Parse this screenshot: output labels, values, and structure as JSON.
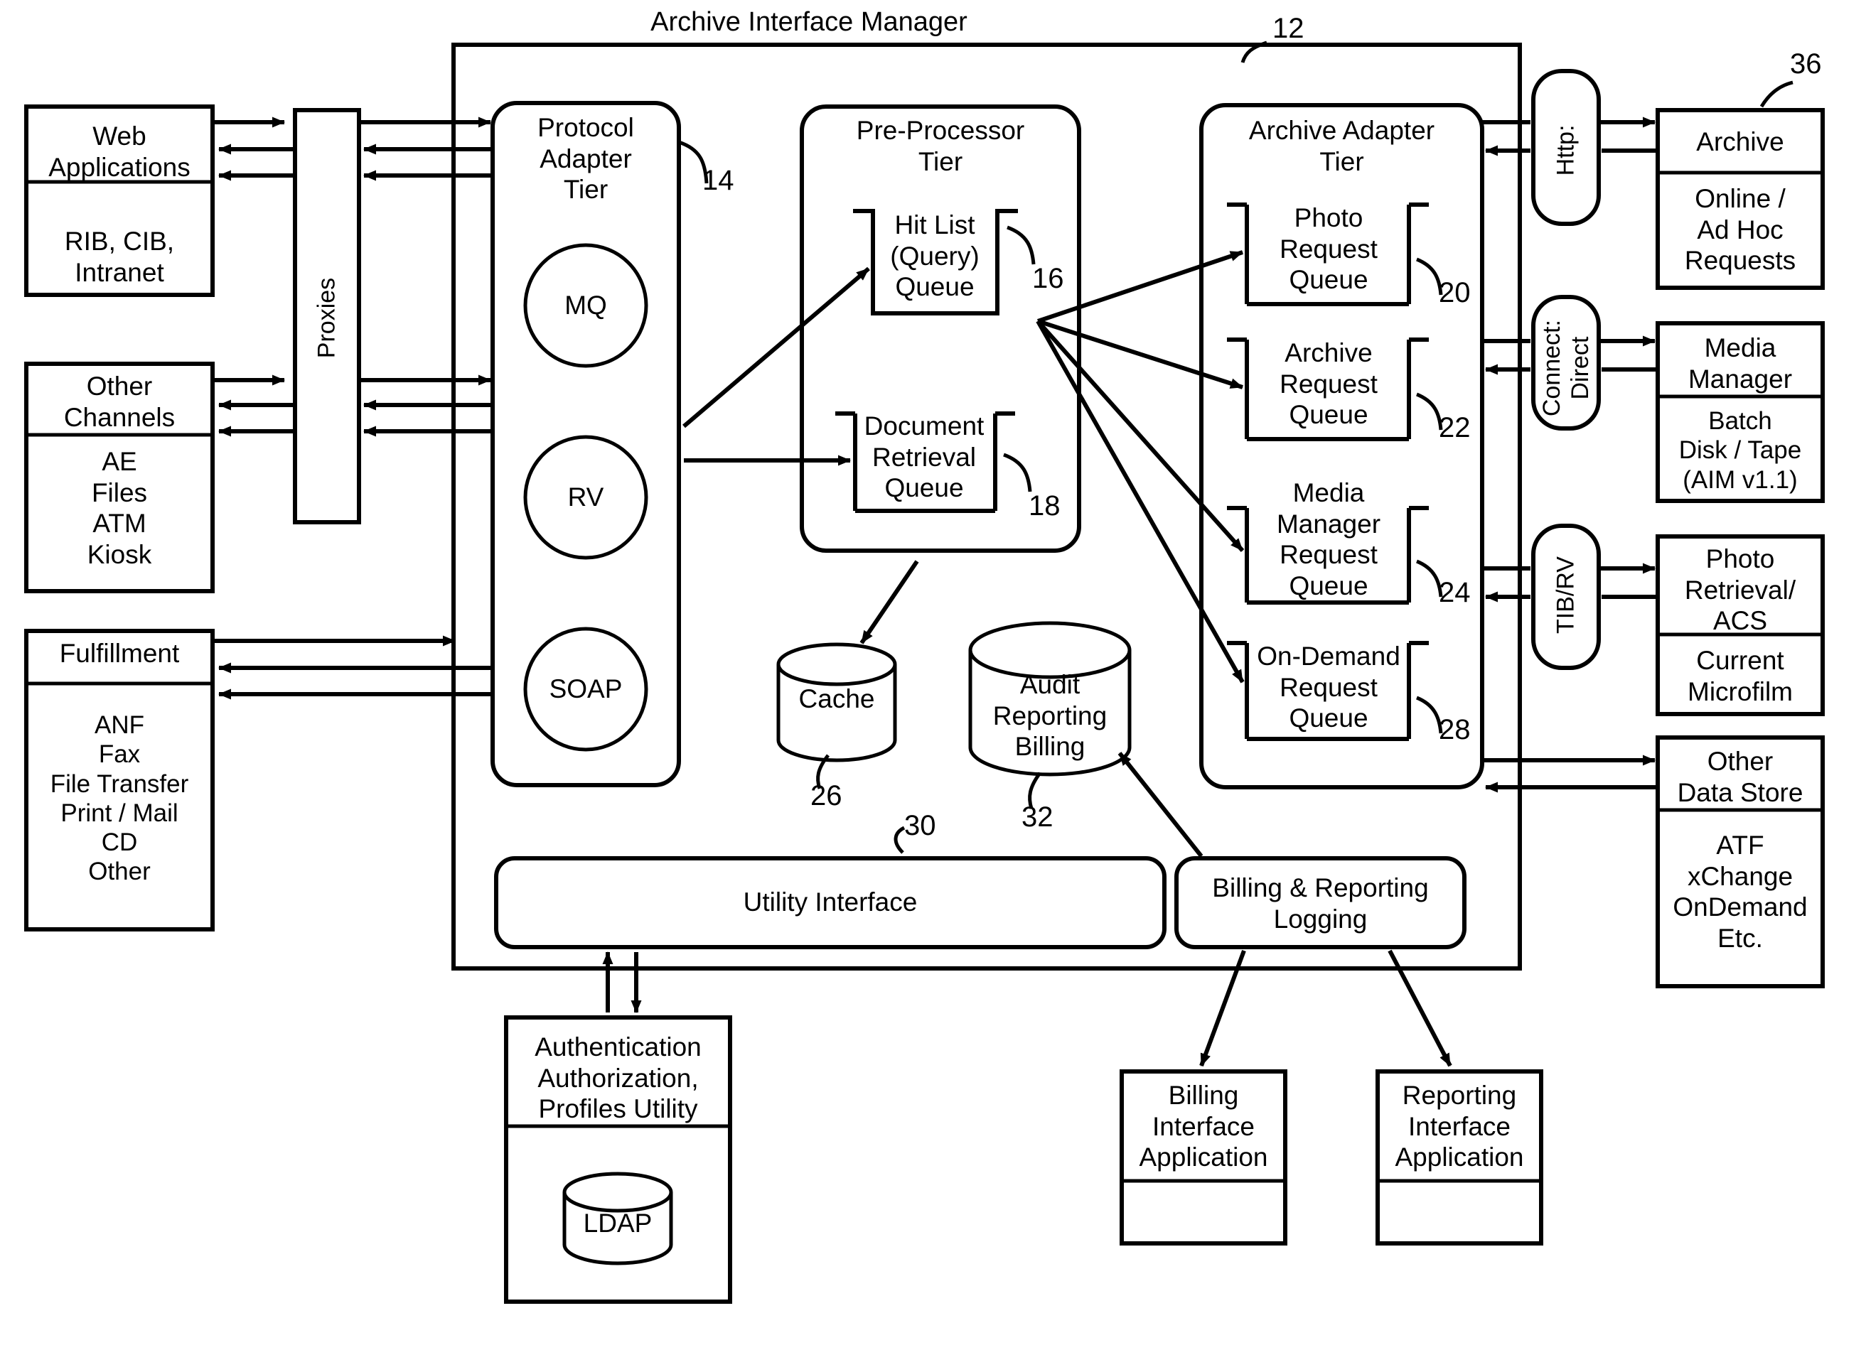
{
  "diagram": {
    "title": "Archive Interface Manager",
    "ref_main": "12"
  },
  "left_column": [
    {
      "name": "web-applications",
      "header": "Web\nApplications",
      "body": "RIB, CIB,\nIntranet"
    },
    {
      "name": "other-channels",
      "header": "Other\nChannels",
      "body": "AE\nFiles\nATM\nKiosk"
    },
    {
      "name": "fulfillment",
      "header": "Fulfillment",
      "body": "ANF\nFax\nFile Transfer\nPrint / Mail\nCD\nOther"
    }
  ],
  "proxies": {
    "label": "Proxies"
  },
  "protocol_adapter_tier": {
    "title": "Protocol\nAdapter\nTier",
    "ref": "14",
    "adapters": [
      {
        "label": "MQ"
      },
      {
        "label": "RV"
      },
      {
        "label": "SOAP"
      }
    ]
  },
  "pre_processor_tier": {
    "title": "Pre-Processor\nTier",
    "queues": [
      {
        "label": "Hit List\n(Query)\nQueue",
        "ref": "16"
      },
      {
        "label": "Document\nRetrieval\nQueue",
        "ref": "18"
      }
    ]
  },
  "archive_adapter_tier": {
    "title": "Archive Adapter\nTier",
    "queues": [
      {
        "label": "Photo\nRequest\nQueue",
        "ref": "20"
      },
      {
        "label": "Archive\nRequest\nQueue",
        "ref": "22"
      },
      {
        "label": "Media\nManager\nRequest\nQueue",
        "ref": "24"
      },
      {
        "label": "On-Demand\nRequest\nQueue",
        "ref": "28"
      }
    ]
  },
  "datastores": [
    {
      "name": "cache",
      "label": "Cache",
      "ref": "26"
    },
    {
      "name": "audit-reporting-billing",
      "label": "Audit\nReporting\nBilling",
      "ref": "32"
    }
  ],
  "utility_interface": {
    "label": "Utility Interface",
    "ref": "30"
  },
  "billing_reporting_logging": {
    "label": "Billing & Reporting\nLogging"
  },
  "auth_utility": {
    "header": "Authentication\nAuthorization,\nProfiles Utility",
    "store": "LDAP"
  },
  "bottom_apps": [
    {
      "name": "billing-interface-application",
      "label": "Billing\nInterface\nApplication"
    },
    {
      "name": "reporting-interface-application",
      "label": "Reporting\nInterface\nApplication"
    }
  ],
  "protocol_connectors": [
    {
      "name": "http-connector",
      "label": "Http:"
    },
    {
      "name": "connect-direct-connector",
      "label": "Connect:\nDirect"
    },
    {
      "name": "tib-rv-connector",
      "label": "TIB/RV"
    }
  ],
  "right_column": [
    {
      "name": "archive",
      "header": "Archive",
      "body": "Online /\nAd Hoc\nRequests",
      "ref": "36"
    },
    {
      "name": "media-manager",
      "header": "Media\nManager",
      "body": "Batch\nDisk / Tape\n(AIM v1.1)"
    },
    {
      "name": "photo-retrieval-acs",
      "header": "Photo\nRetrieval/\nACS",
      "body": "Current\nMicrofilm"
    },
    {
      "name": "other-data-store",
      "header": "Other\nData Store",
      "body": "ATF\nxChange\nOnDemand\nEtc."
    }
  ]
}
